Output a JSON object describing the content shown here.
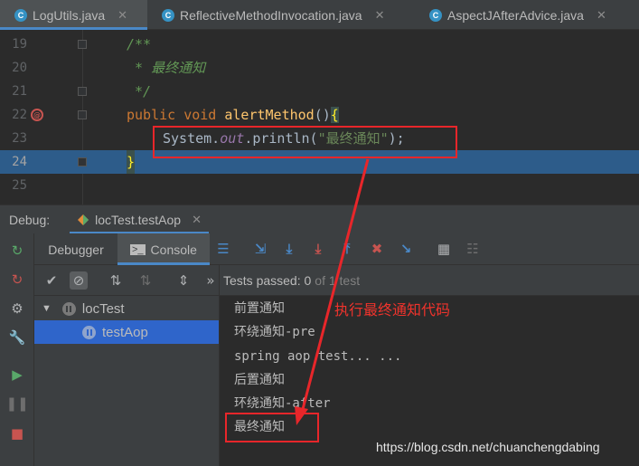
{
  "tabs": [
    {
      "label": "LogUtils.java",
      "icon": "C",
      "active": true
    },
    {
      "label": "ReflectiveMethodInvocation.java",
      "icon": "C",
      "active": false
    },
    {
      "label": "AspectJAfterAdvice.java",
      "icon": "C",
      "active": false
    }
  ],
  "editor": {
    "lines": [
      {
        "num": "19",
        "code": "/**"
      },
      {
        "num": "20",
        "code": " * 最终通知"
      },
      {
        "num": "21",
        "code": " */"
      },
      {
        "num": "22",
        "kw1": "public",
        "kw2": "void",
        "method": "alertMethod",
        "paren": "()",
        "brace": "{"
      },
      {
        "num": "23",
        "obj": "System.",
        "field": "out",
        "call": ".println(",
        "str": "\"最终通知\"",
        "end": ");"
      },
      {
        "num": "24",
        "code": "}"
      },
      {
        "num": "25",
        "code": ""
      }
    ]
  },
  "debug": {
    "label": "Debug:",
    "session": "locTest.testAop",
    "tabs": {
      "debugger": "Debugger",
      "console": "Console"
    },
    "more": "»"
  },
  "status": {
    "passed": "Tests passed: 0",
    "of": "of 1 test"
  },
  "tree": [
    {
      "label": "locTest",
      "expanded": true,
      "selected": false
    },
    {
      "label": "testAop",
      "selected": true
    }
  ],
  "console": [
    "前置通知",
    "环绕通知-pre",
    "spring aop test... ...",
    "后置通知",
    "环绕通知-after",
    "最终通知"
  ],
  "annotation": {
    "text": "执行最终通知代码",
    "color": "#e8262a"
  },
  "watermark": "https://blog.csdn.net/chuanchengdabing",
  "colors": {
    "accent": "#4a88c7",
    "selection": "#2f65ca",
    "highlight_line": "#2d5c8a"
  }
}
